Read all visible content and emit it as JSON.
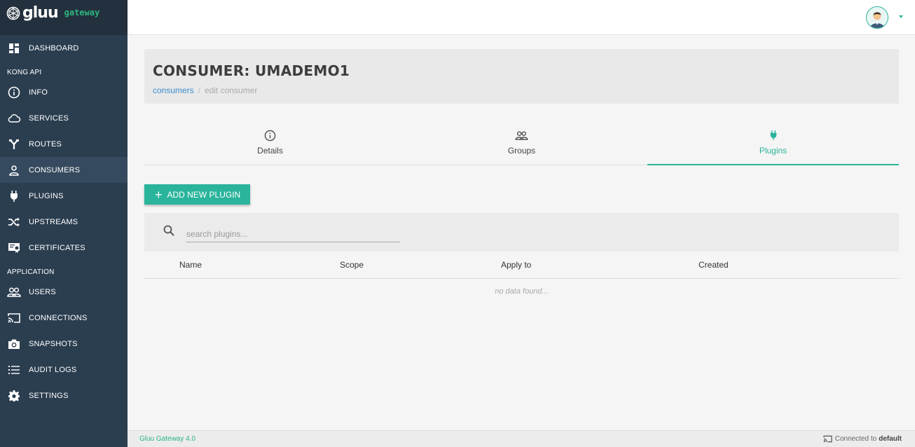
{
  "brand": {
    "logo_text": "gluu",
    "sub_text": "gateway"
  },
  "sidebar": {
    "dashboard": "DASHBOARD",
    "section_kong": "KONG API",
    "kong_items": [
      {
        "label": "INFO",
        "icon": "info-icon"
      },
      {
        "label": "SERVICES",
        "icon": "cloud-icon"
      },
      {
        "label": "ROUTES",
        "icon": "routes-icon"
      },
      {
        "label": "CONSUMERS",
        "icon": "user-icon",
        "active": true
      },
      {
        "label": "PLUGINS",
        "icon": "plug-icon"
      },
      {
        "label": "UPSTREAMS",
        "icon": "shuffle-icon"
      },
      {
        "label": "CERTIFICATES",
        "icon": "certificate-icon"
      }
    ],
    "section_app": "APPLICATION",
    "app_items": [
      {
        "label": "USERS",
        "icon": "users-icon"
      },
      {
        "label": "CONNECTIONS",
        "icon": "cast-icon"
      },
      {
        "label": "SNAPSHOTS",
        "icon": "camera-icon"
      },
      {
        "label": "AUDIT LOGS",
        "icon": "list-icon"
      },
      {
        "label": "SETTINGS",
        "icon": "gear-icon"
      }
    ]
  },
  "page": {
    "title": "CONSUMER: UMADEMO1",
    "breadcrumb": {
      "link": "consumers",
      "separator": "/",
      "current": "edit consumer"
    }
  },
  "tabs": [
    {
      "label": "Details",
      "icon": "info-icon"
    },
    {
      "label": "Groups",
      "icon": "users-icon"
    },
    {
      "label": "Plugins",
      "icon": "plug-icon",
      "active": true
    }
  ],
  "actions": {
    "add_plugin": "ADD NEW PLUGIN"
  },
  "search": {
    "placeholder": "search plugins..."
  },
  "table": {
    "columns": [
      "Name",
      "Scope",
      "Apply to",
      "Created"
    ],
    "empty_text": "no data found..."
  },
  "footer": {
    "version": "Gluu Gateway 4.0",
    "connected_prefix": "Connected to",
    "connection_name": "default"
  },
  "colors": {
    "accent": "#2ab49b",
    "sidebar_bg": "#2b3e50",
    "brand_green": "#2ab67f"
  }
}
